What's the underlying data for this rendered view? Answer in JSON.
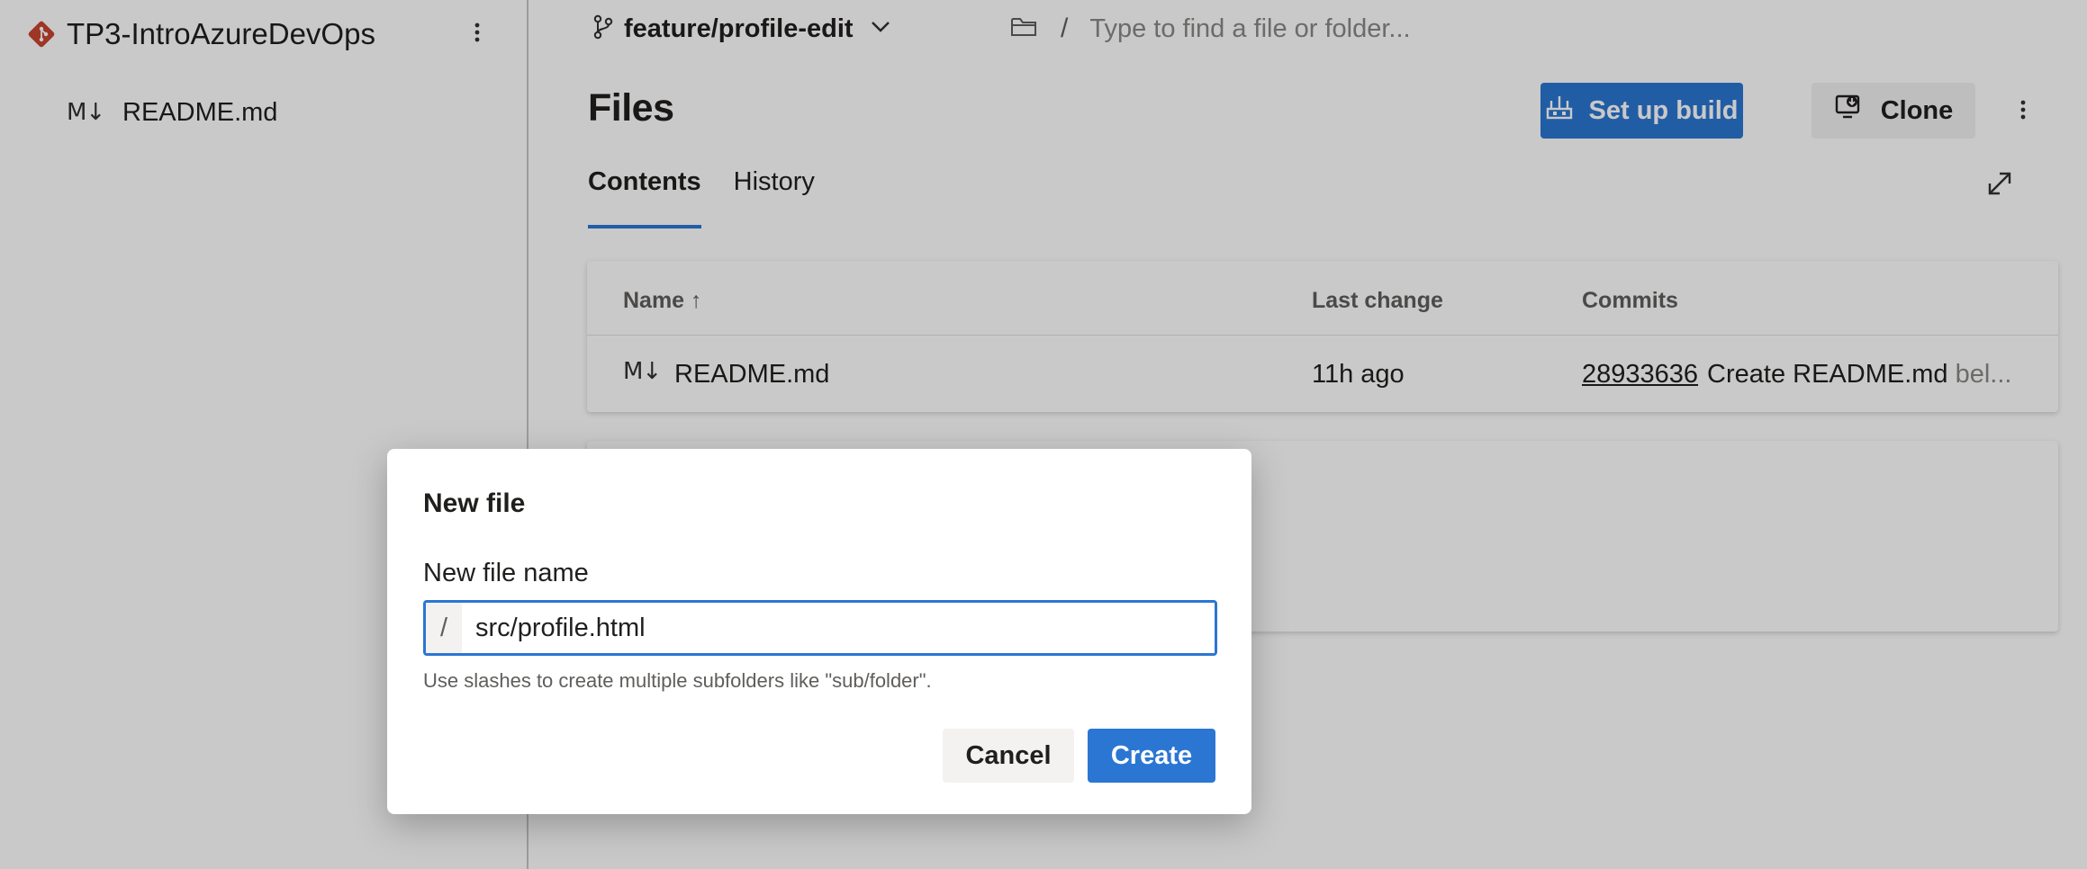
{
  "sidebar": {
    "repo_name": "TP3-IntroAzureDevOps",
    "repo_icon": "git-repo-icon",
    "items": [
      {
        "label": "README.md",
        "icon": "markdown-icon"
      }
    ]
  },
  "toolbar": {
    "branch": "feature/profile-edit",
    "path_separator": "/",
    "path_placeholder": "Type to find a file or folder..."
  },
  "page": {
    "title": "Files",
    "setup_build_label": "Set up build",
    "clone_label": "Clone",
    "tabs": [
      {
        "label": "Contents",
        "active": true
      },
      {
        "label": "History",
        "active": false
      }
    ]
  },
  "table": {
    "columns": {
      "name": "Name",
      "sort_arrow": "↑",
      "last_change": "Last change",
      "commits": "Commits"
    },
    "rows": [
      {
        "icon": "M↓",
        "name": "README.md",
        "last_change": "11h ago",
        "commit_hash": "28933636",
        "commit_message": "Create README.md",
        "commit_author": "bel..."
      }
    ]
  },
  "dialog": {
    "title": "New file",
    "field_label": "New file name",
    "prefix": "/",
    "value": "src/profile.html",
    "help_text": "Use slashes to create multiple subfolders like \"sub/folder\".",
    "cancel_label": "Cancel",
    "create_label": "Create"
  },
  "colors": {
    "accent": "#2b76d2",
    "git_logo": "#c8452f",
    "overlay": "rgba(0,0,0,0.21)"
  }
}
